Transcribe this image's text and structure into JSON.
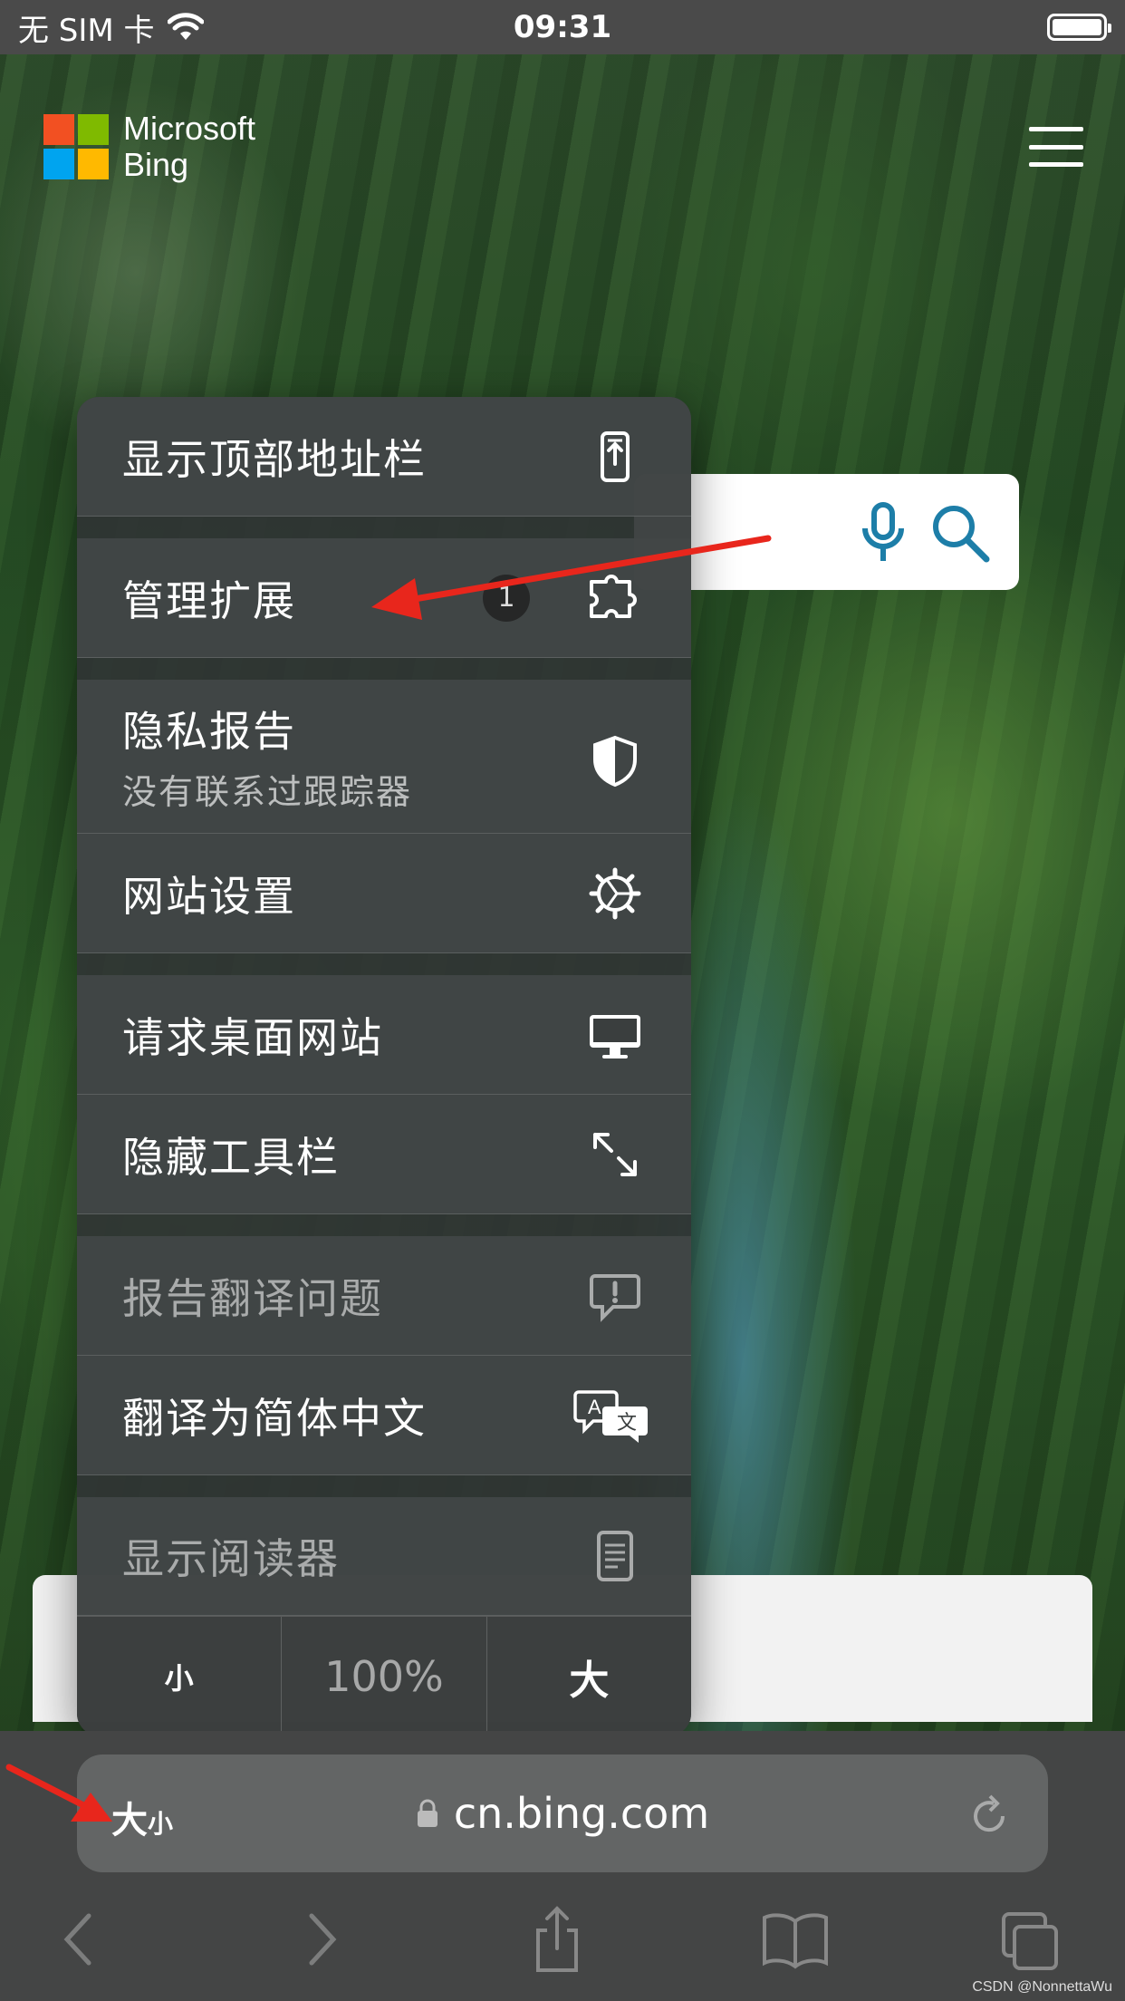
{
  "status_bar": {
    "carrier": "无 SIM 卡",
    "time": "09:31"
  },
  "bing": {
    "brand_line1": "Microsoft",
    "brand_line2": "Bing"
  },
  "menu": {
    "items": [
      {
        "label": "显示顶部地址栏",
        "icon": "address-bar-top-icon"
      },
      {
        "label": "管理扩展",
        "badge": "1",
        "icon": "extension-puzzle-icon"
      },
      {
        "label": "隐私报告",
        "sublabel": "没有联系过跟踪器",
        "icon": "shield-icon"
      },
      {
        "label": "网站设置",
        "icon": "gear-icon"
      },
      {
        "label": "请求桌面网站",
        "icon": "desktop-icon"
      },
      {
        "label": "隐藏工具栏",
        "icon": "expand-arrows-icon"
      },
      {
        "label": "报告翻译问题",
        "icon": "report-bubble-icon",
        "disabled": true
      },
      {
        "label": "翻译为简体中文",
        "icon": "translate-icon"
      },
      {
        "label": "显示阅读器",
        "icon": "reader-icon",
        "disabled": true
      }
    ],
    "zoom": {
      "smaller": "小",
      "level": "100%",
      "larger": "大"
    }
  },
  "address_bar": {
    "aa_big": "大",
    "aa_small": "小",
    "url": "cn.bing.com"
  },
  "watermark": "CSDN @NonnettaWu",
  "colors": {
    "annotation_red": "#e8261c",
    "bing_blue": "#1d7ea8"
  }
}
